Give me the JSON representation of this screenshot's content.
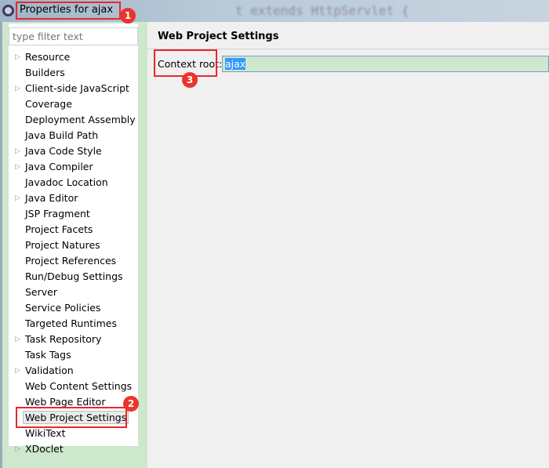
{
  "window": {
    "title": "Properties for ajax",
    "background_code": "t  extends HttpServlet {"
  },
  "filter": {
    "placeholder": "type filter text"
  },
  "tree": {
    "items": [
      {
        "label": "Resource",
        "expandable": true
      },
      {
        "label": "Builders",
        "expandable": false
      },
      {
        "label": "Client-side JavaScript",
        "expandable": true
      },
      {
        "label": "Coverage",
        "expandable": false
      },
      {
        "label": "Deployment Assembly",
        "expandable": false
      },
      {
        "label": "Java Build Path",
        "expandable": false
      },
      {
        "label": "Java Code Style",
        "expandable": true
      },
      {
        "label": "Java Compiler",
        "expandable": true
      },
      {
        "label": "Javadoc Location",
        "expandable": false
      },
      {
        "label": "Java Editor",
        "expandable": true
      },
      {
        "label": "JSP Fragment",
        "expandable": false
      },
      {
        "label": "Project Facets",
        "expandable": false
      },
      {
        "label": "Project Natures",
        "expandable": false
      },
      {
        "label": "Project References",
        "expandable": false
      },
      {
        "label": "Run/Debug Settings",
        "expandable": false
      },
      {
        "label": "Server",
        "expandable": false
      },
      {
        "label": "Service Policies",
        "expandable": false
      },
      {
        "label": "Targeted Runtimes",
        "expandable": false
      },
      {
        "label": "Task Repository",
        "expandable": true
      },
      {
        "label": "Task Tags",
        "expandable": false
      },
      {
        "label": "Validation",
        "expandable": true
      },
      {
        "label": "Web Content Settings",
        "expandable": false
      },
      {
        "label": "Web Page Editor",
        "expandable": false
      },
      {
        "label": "Web Project Settings",
        "expandable": false,
        "selected": true
      },
      {
        "label": "WikiText",
        "expandable": false
      },
      {
        "label": "XDoclet",
        "expandable": true
      }
    ]
  },
  "page": {
    "heading": "Web Project Settings",
    "context_root_label": "Context root:",
    "context_root_value": "ajax"
  },
  "annotations": [
    "1",
    "2",
    "3"
  ],
  "colors": {
    "annotation": "#e8282c",
    "panel_green": "#cde8cd",
    "selection": "#3399ff"
  }
}
